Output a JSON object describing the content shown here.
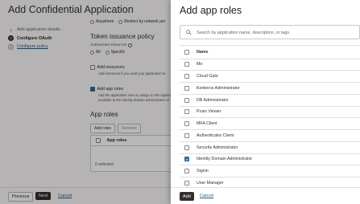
{
  "background": {
    "title": "Add Confidential Application",
    "steps": [
      {
        "num": "1",
        "label": "Add application details"
      },
      {
        "num": "2",
        "label": "Configure OAuth"
      },
      {
        "num": "3",
        "label": "Configure policy"
      }
    ],
    "top_options": {
      "anywhere": "Anywhere",
      "restrict": "Restrict by network per"
    },
    "token_title": "Token issuance policy",
    "authorized_resources": "Authorized resources",
    "resource_options": {
      "all": "All",
      "specific": "Specific"
    },
    "add_resources": {
      "label": "Add resources",
      "desc": "Add resources if you want your application to"
    },
    "add_app_roles": {
      "label": "Add app roles",
      "desc1": "Add the application roles to assign to this applicat",
      "desc2": "available to the Identity domain administrator or"
    },
    "app_roles_title": "App roles",
    "add_roles_btn": "Add roles",
    "remove_btn": "Remove",
    "table_header": "App roles",
    "selected_count": "0 selected",
    "footer": {
      "previous": "Previous",
      "next": "Next",
      "cancel": "Cancel"
    }
  },
  "drawer": {
    "title": "Add app roles",
    "search_placeholder": "Search by application name, description, or tags.",
    "column_header": "Name",
    "rows": [
      {
        "name": "Me",
        "checked": false
      },
      {
        "name": "Cloud Gate",
        "checked": false
      },
      {
        "name": "Kerberos Administrator",
        "checked": false
      },
      {
        "name": "DB Administrator",
        "checked": false
      },
      {
        "name": "Posix Viewer",
        "checked": false
      },
      {
        "name": "MFA Client",
        "checked": false
      },
      {
        "name": "Authenticator Client",
        "checked": false
      },
      {
        "name": "Security Administrator",
        "checked": false
      },
      {
        "name": "Identity Domain Administrator",
        "checked": true
      },
      {
        "name": "Signin",
        "checked": false
      },
      {
        "name": "User Manager",
        "checked": false
      }
    ],
    "add_label": "Add",
    "cancel_label": "Cancel"
  }
}
